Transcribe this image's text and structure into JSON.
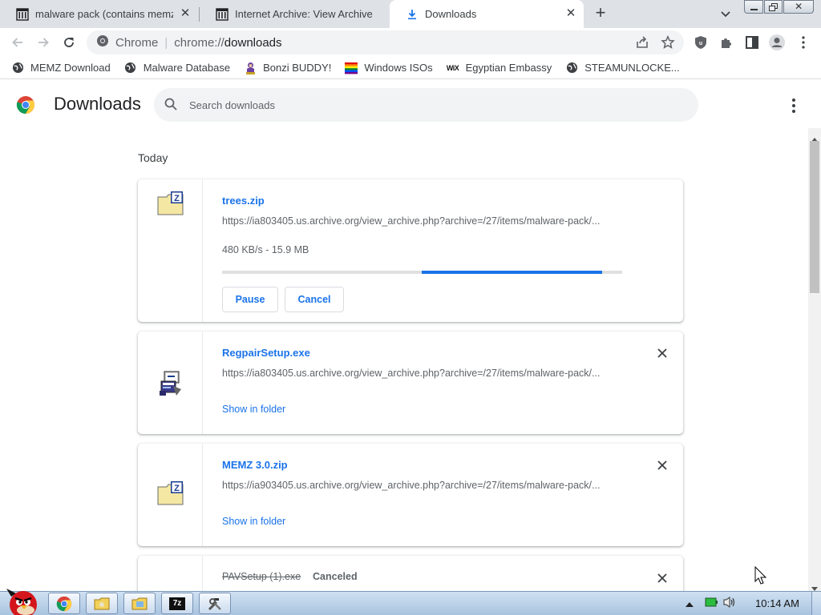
{
  "tabs": [
    {
      "title": "malware pack (contains memz",
      "icon": "archive-columns-icon",
      "active": false
    },
    {
      "title": "Internet Archive: View Archive",
      "icon": "archive-columns-icon",
      "active": false
    },
    {
      "title": "Downloads",
      "icon": "download-arrow-icon",
      "active": true
    }
  ],
  "omnibox": {
    "chip": "Chrome",
    "url_scheme": "chrome://",
    "url_host": "downloads"
  },
  "bookmarks": [
    {
      "label": "MEMZ Download",
      "icon": "globe-icon"
    },
    {
      "label": "Malware Database",
      "icon": "globe-icon"
    },
    {
      "label": "Bonzi BUDDY!",
      "icon": "bonzi-icon"
    },
    {
      "label": "Windows ISOs",
      "icon": "rainbow-flag-icon"
    },
    {
      "label": "Egyptian Embassy",
      "icon": "wix-icon"
    },
    {
      "label": "STEAMUNLOCKE...",
      "icon": "globe-icon"
    }
  ],
  "page": {
    "title": "Downloads",
    "search_placeholder": "Search downloads",
    "date_header": "Today"
  },
  "downloads": [
    {
      "name": "trees.zip",
      "url": "https://ia803405.us.archive.org/view_archive.php?archive=/27/items/malware-pack/...",
      "status": "480 KB/s - 15.9 MB",
      "progress_fraction": 0.5,
      "pause_label": "Pause",
      "cancel_label": "Cancel",
      "icon": "zip-folder-icon"
    },
    {
      "name": "RegpairSetup.exe",
      "url": "https://ia803405.us.archive.org/view_archive.php?archive=/27/items/malware-pack/...",
      "link": "Show in folder",
      "icon": "setup-exe-icon"
    },
    {
      "name": "MEMZ 3.0.zip",
      "url": "https://ia903405.us.archive.org/view_archive.php?archive=/27/items/malware-pack/...",
      "link": "Show in folder",
      "icon": "zip-folder-icon"
    },
    {
      "name": "PAVSetup (1).exe",
      "status_tag": "Canceled"
    }
  ],
  "taskbar": {
    "clock": "10:14 AM"
  },
  "colors": {
    "accent": "#1a73e8",
    "tabstrip": "#dee1e6",
    "progress_track": "#e0e0e0"
  }
}
